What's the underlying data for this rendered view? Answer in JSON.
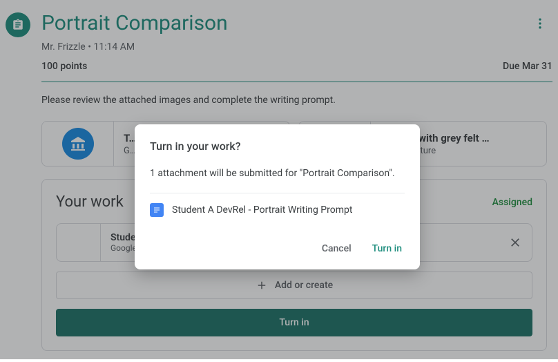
{
  "header": {
    "title": "Portrait Comparison",
    "author": "Mr. Frizzle",
    "time": "11:14 AM",
    "subtitle_sep": " • "
  },
  "meta": {
    "points": "100 points",
    "due": "Due Mar 31"
  },
  "description": "Please review the attached images and complete the writing prompt.",
  "attachments": [
    {
      "title": "T…",
      "source": "G…"
    },
    {
      "title": "Portrait with grey felt …",
      "source": "Arts & Culture"
    }
  ],
  "work": {
    "heading": "Your work",
    "status": "Assigned",
    "item": {
      "title": "Studer…",
      "type": "Google …"
    },
    "add_create": "Add or create",
    "turn_in": "Turn in"
  },
  "dialog": {
    "title": "Turn in your work?",
    "body": "1 attachment will be submitted for \"Portrait Comparison\".",
    "attachment": "Student A DevRel - Portrait Writing Prompt",
    "cancel": "Cancel",
    "confirm": "Turn in"
  }
}
